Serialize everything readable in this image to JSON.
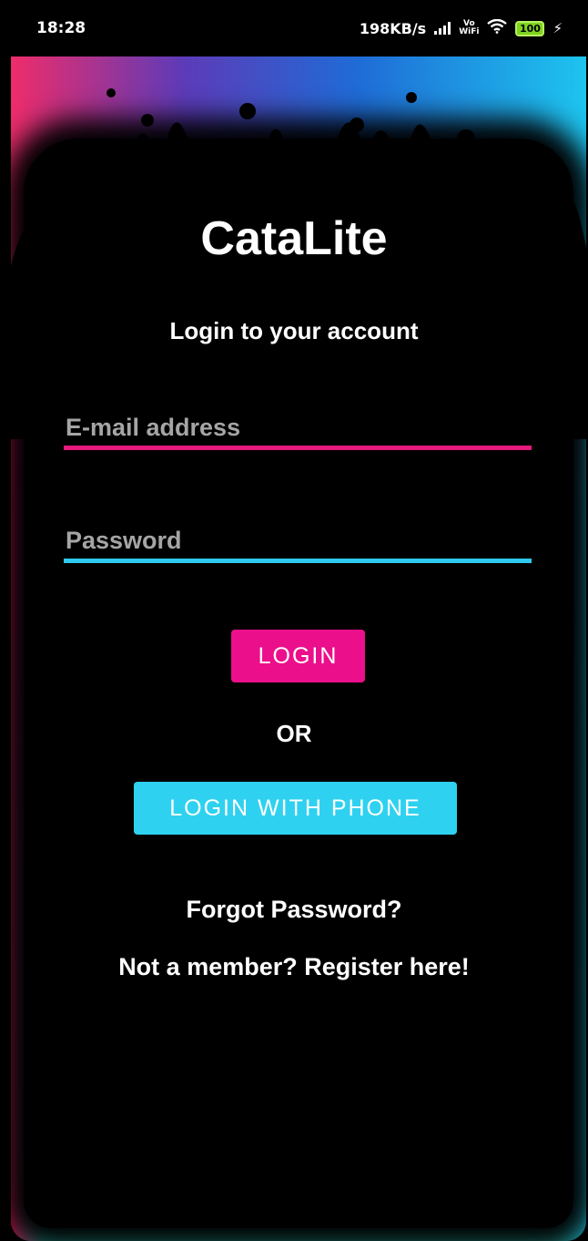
{
  "status_bar": {
    "time": "18:28",
    "network_speed": "198KB/s",
    "vowifi_top": "Vo",
    "vowifi_bottom": "WiFi",
    "battery": "100"
  },
  "app": {
    "title": "CataLite",
    "subtitle": "Login to your account"
  },
  "form": {
    "email_placeholder": "E-mail address",
    "password_placeholder": "Password",
    "login_button": "LOGIN",
    "or_label": "OR",
    "phone_button": "LOGIN WITH PHONE",
    "forgot_link": "Forgot Password?",
    "register_link": "Not a member? Register here!"
  },
  "colors": {
    "accent_pink": "#ec0f8b",
    "accent_cyan": "#2fd1f0",
    "background": "#000000"
  }
}
